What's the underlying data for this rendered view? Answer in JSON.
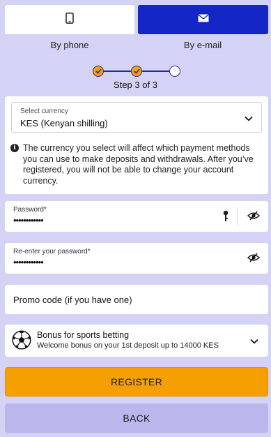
{
  "login_methods": {
    "phone": {
      "label": "By phone",
      "icon": "phone-icon"
    },
    "email": {
      "label": "By e-mail",
      "icon": "envelope-icon",
      "active": true
    }
  },
  "stepper": {
    "current": 3,
    "total": 3,
    "text": "Step 3 of 3"
  },
  "currency": {
    "label": "Select currency",
    "value": "KES  (Kenyan shilling)",
    "info": "The currency you select will affect which payment methods you can use to make deposits and withdrawals. After you’ve registered, you will not be able to change your account currency."
  },
  "password": {
    "label": "Password*",
    "value": "••••••••••••"
  },
  "confirm_password": {
    "label": "Re-enter your password*",
    "value": "••••••••••••"
  },
  "promo": {
    "placeholder": "Promo code (if you have one)"
  },
  "bonus": {
    "title": "Bonus for sports betting",
    "subtitle": "Welcome bonus on your 1st deposit up to 14000 KES",
    "icon": "soccer-ball-icon"
  },
  "buttons": {
    "register": "REGISTER",
    "back": "BACK"
  },
  "colors": {
    "background": "#d4d3f5",
    "accent": "#1526c7",
    "primary": "#f5a000",
    "secondary": "#b9b7ec"
  }
}
